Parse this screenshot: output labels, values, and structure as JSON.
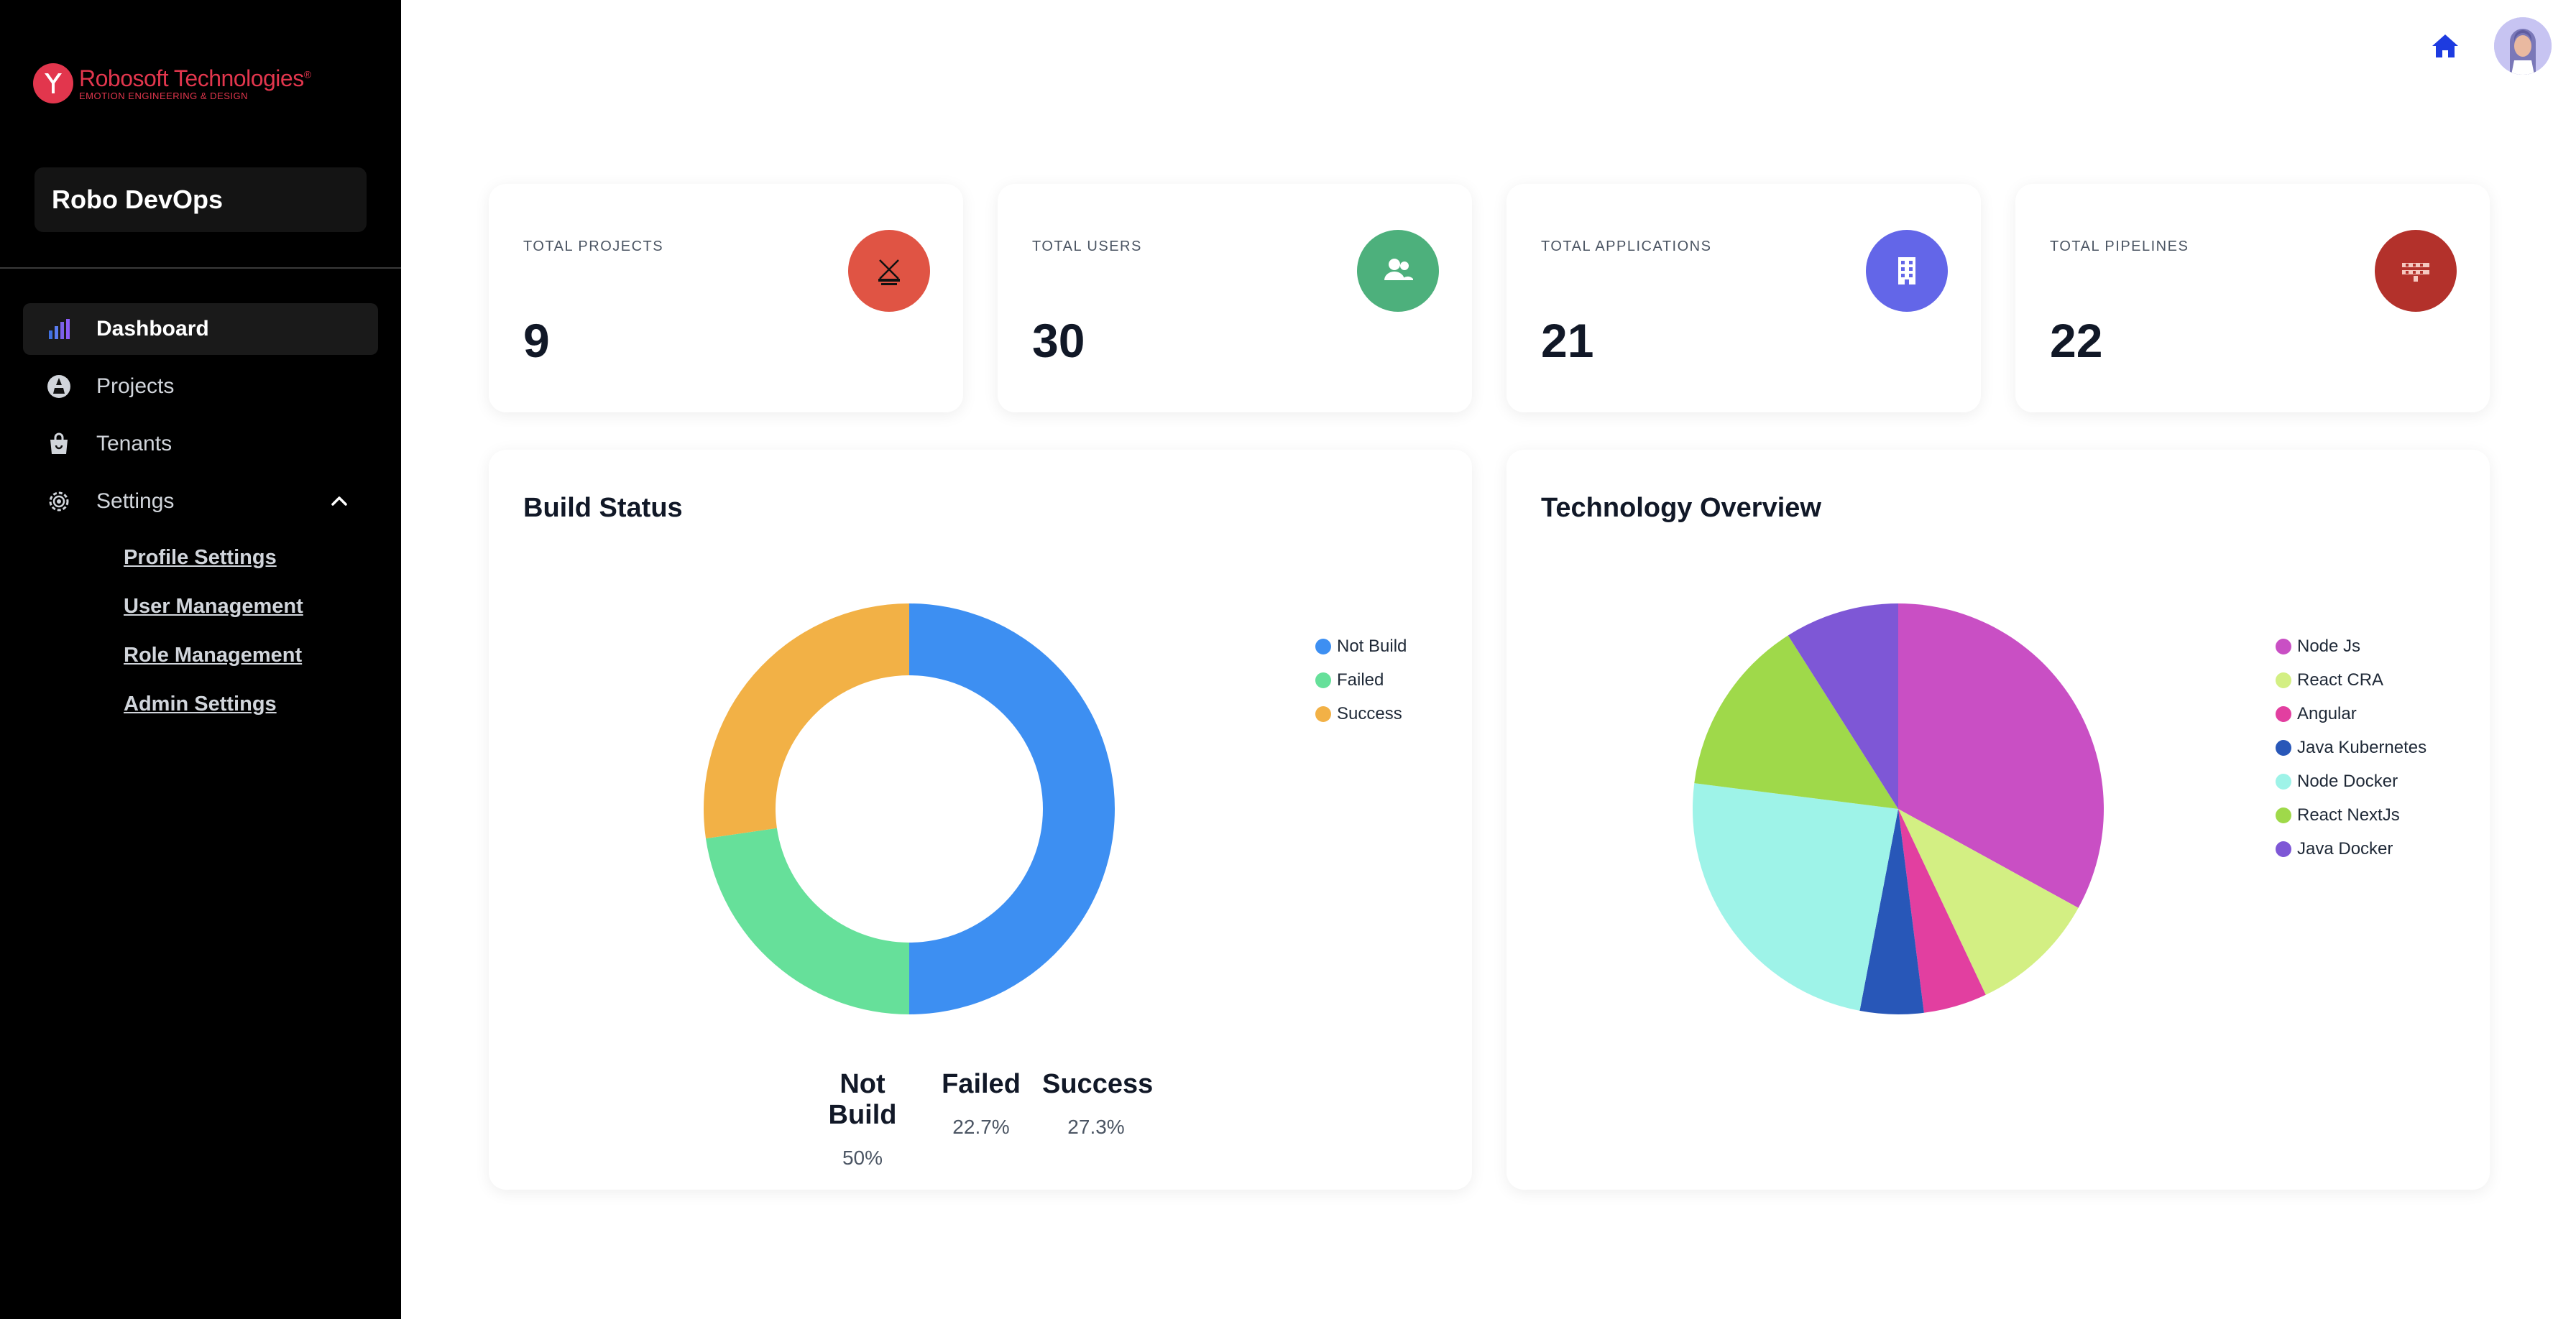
{
  "brand": {
    "name": "Robosoft Technologies",
    "trademark": "®",
    "tagline": "EMOTION ENGINEERING & DESIGN",
    "color": "#e2364d"
  },
  "app": {
    "name": "Robo DevOps"
  },
  "sidebar": {
    "items": [
      {
        "label": "Dashboard",
        "icon": "bar-chart-icon",
        "active": true
      },
      {
        "label": "Projects",
        "icon": "projects-icon"
      },
      {
        "label": "Tenants",
        "icon": "shopping-bag-icon"
      },
      {
        "label": "Settings",
        "icon": "gear-icon",
        "expanded": true
      }
    ],
    "settings_subitems": [
      {
        "label": "Profile Settings"
      },
      {
        "label": "User Management"
      },
      {
        "label": "Role Management"
      },
      {
        "label": "Admin Settings"
      }
    ]
  },
  "header": {
    "home_icon": "home-icon",
    "avatar": "user-avatar"
  },
  "stats": [
    {
      "title": "TOTAL PROJECTS",
      "value": "9",
      "icon": "crane-icon",
      "color": "#e05444"
    },
    {
      "title": "TOTAL USERS",
      "value": "30",
      "icon": "users-icon",
      "color": "#4db07c"
    },
    {
      "title": "TOTAL APPLICATIONS",
      "value": "21",
      "icon": "building-icon",
      "color": "#6366e8"
    },
    {
      "title": "TOTAL PIPELINES",
      "value": "22",
      "icon": "pipeline-icon",
      "color": "#b3312b"
    }
  ],
  "chart_data": [
    {
      "type": "pie",
      "variant": "donut",
      "title": "Build Status",
      "categories": [
        "Not Build",
        "Failed",
        "Success"
      ],
      "values": [
        50,
        22.7,
        27.3
      ],
      "colors": [
        "#3d8ff2",
        "#66e09a",
        "#f2b146"
      ],
      "value_labels": [
        "50%",
        "22.7%",
        "27.3%"
      ],
      "legend_position": "right"
    },
    {
      "type": "pie",
      "title": "Technology Overview",
      "categories": [
        "Node Js",
        "React CRA",
        "Angular",
        "Java Kubernetes",
        "Node Docker",
        "React NextJs",
        "Java Docker"
      ],
      "values": [
        33,
        10,
        5,
        5,
        24,
        14,
        9
      ],
      "colors": [
        "#c94fc4",
        "#d3ef83",
        "#e23fa0",
        "#2857b8",
        "#9ef3e8",
        "#9fd94a",
        "#7e57d6"
      ],
      "legend_position": "right"
    }
  ]
}
